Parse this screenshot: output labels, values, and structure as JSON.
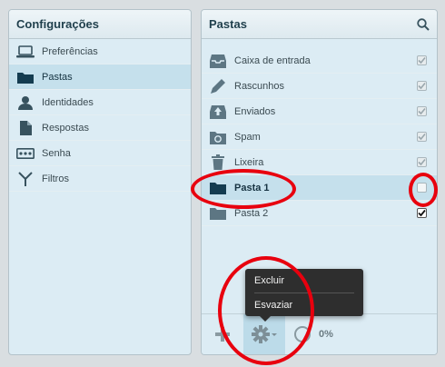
{
  "left_panel": {
    "title": "Configurações",
    "items": [
      {
        "label": "Preferências",
        "icon": "laptop-icon",
        "active": false
      },
      {
        "label": "Pastas",
        "icon": "folder-icon",
        "active": true
      },
      {
        "label": "Identidades",
        "icon": "person-icon",
        "active": false
      },
      {
        "label": "Respostas",
        "icon": "document-icon",
        "active": false
      },
      {
        "label": "Senha",
        "icon": "password-icon",
        "active": false
      },
      {
        "label": "Filtros",
        "icon": "filter-icon",
        "active": false
      }
    ]
  },
  "right_panel": {
    "title": "Pastas",
    "search_icon": "search-icon",
    "folders": [
      {
        "label": "Caixa de entrada",
        "icon": "inbox-icon",
        "subscribed": true,
        "locked": true
      },
      {
        "label": "Rascunhos",
        "icon": "pencil-icon",
        "subscribed": true,
        "locked": true
      },
      {
        "label": "Enviados",
        "icon": "sent-icon",
        "subscribed": true,
        "locked": true
      },
      {
        "label": "Spam",
        "icon": "spam-icon",
        "subscribed": true,
        "locked": true
      },
      {
        "label": "Lixeira",
        "icon": "trash-icon",
        "subscribed": true,
        "locked": true
      },
      {
        "label": "Pasta 1",
        "icon": "folder-icon",
        "subscribed": false,
        "locked": false,
        "active": true
      },
      {
        "label": "Pasta 2",
        "icon": "folder-icon",
        "subscribed": true,
        "locked": false
      }
    ],
    "footer": {
      "add_icon": "plus-icon",
      "actions_icon": "gear-icon",
      "quota_text": "0%"
    }
  },
  "actions_menu": {
    "items": [
      "Excluir",
      "Esvaziar"
    ]
  },
  "colors": {
    "accent": "#c5e0ec",
    "annotation": "#e8000e",
    "menu_bg": "#2e2e2e"
  }
}
